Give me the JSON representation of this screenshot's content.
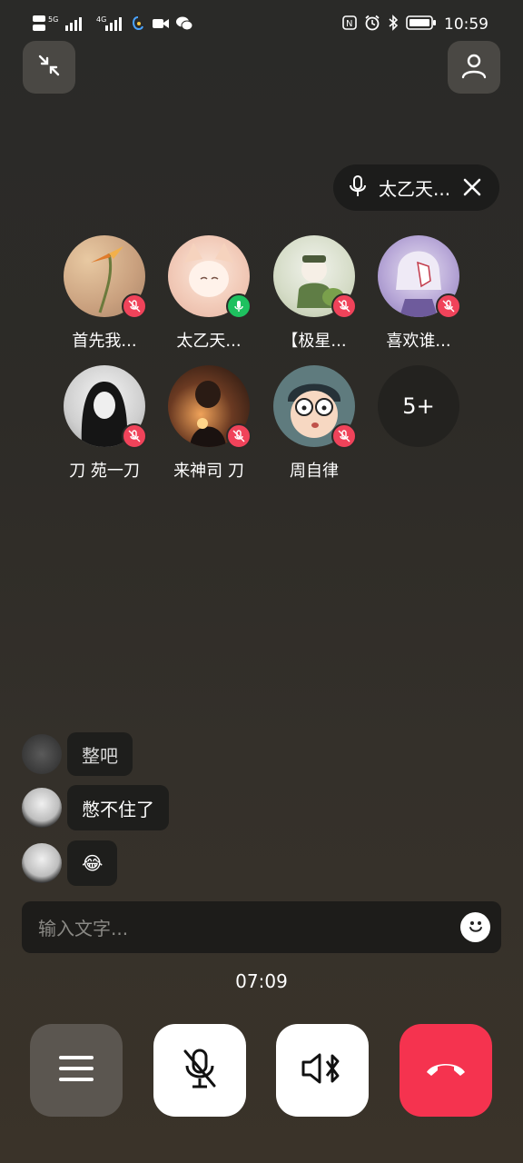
{
  "status": {
    "left_signal_1": "5G",
    "left_signal_2": "4G",
    "time": "10:59"
  },
  "speaker": {
    "name": "太乙天..."
  },
  "participants": [
    {
      "name": "首先我...",
      "mic": "muted"
    },
    {
      "name": "太乙天...",
      "mic": "on"
    },
    {
      "name": "【极星...",
      "mic": "muted"
    },
    {
      "name": "喜欢谁...",
      "mic": "muted"
    },
    {
      "name": "刀  苑一刀",
      "mic": "muted"
    },
    {
      "name": "来神司  刀",
      "mic": "muted"
    },
    {
      "name": "周自律",
      "mic": "muted"
    }
  ],
  "more_count": "5+",
  "chat": [
    {
      "text": "整吧"
    },
    {
      "text": "憋不住了"
    },
    {
      "text": "😂"
    }
  ],
  "input": {
    "placeholder": "输入文字..."
  },
  "call_timer": "07:09",
  "colors": {
    "mute_badge": "#f0435a",
    "on_badge": "#1ec15f",
    "hangup": "#f5334f"
  },
  "icons": {
    "minimize": "minimize-arrows-icon",
    "contacts": "person-icon",
    "menu": "hamburger-icon",
    "mic": "mic-off-icon",
    "speaker": "speaker-bluetooth-icon",
    "hangup": "phone-hangup-icon"
  }
}
